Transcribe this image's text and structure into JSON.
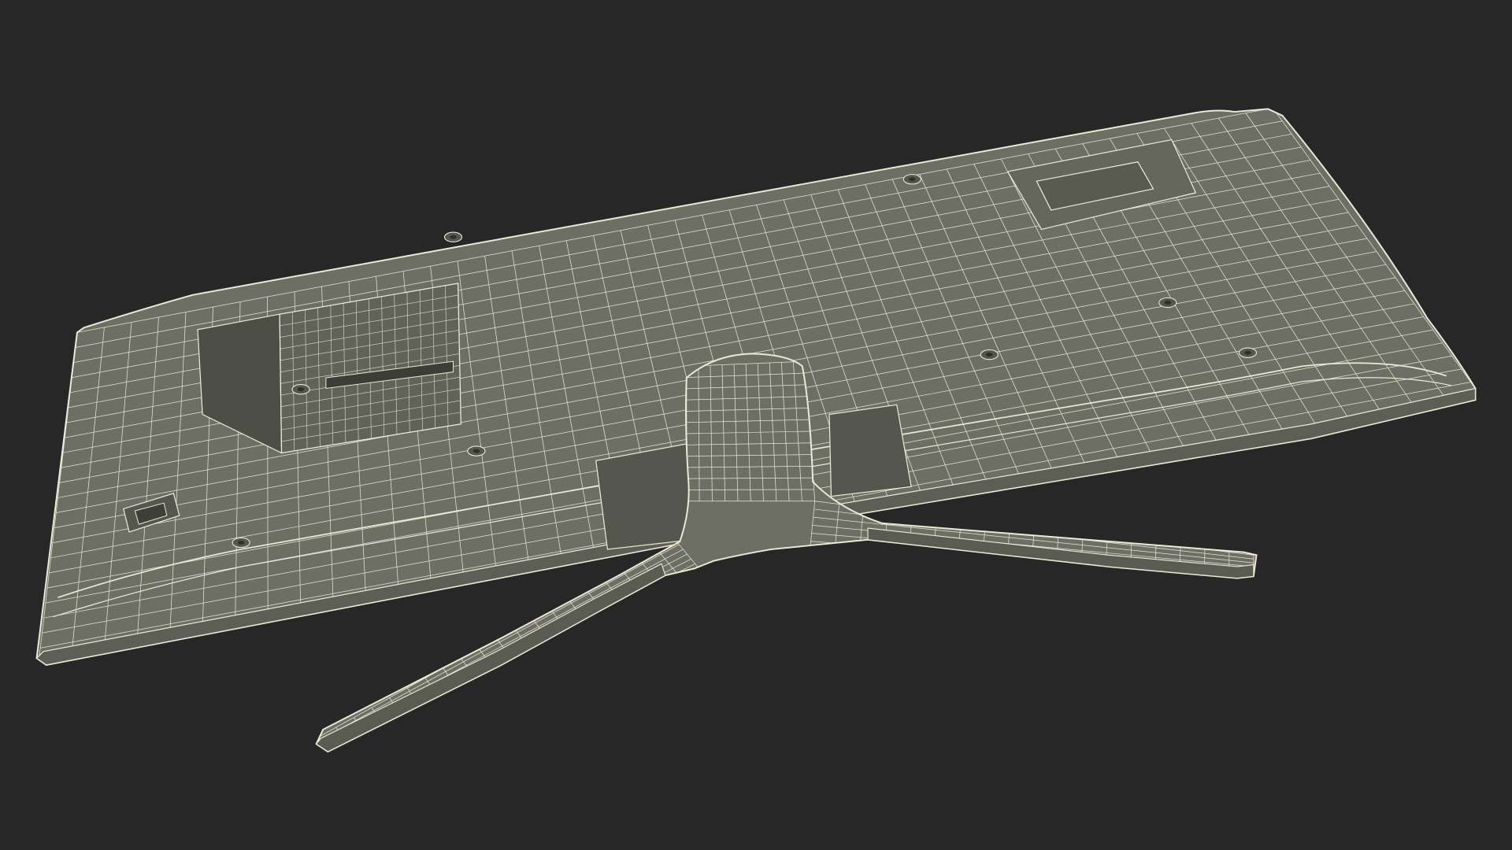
{
  "scene": {
    "subject": "monitor-wireframe-render",
    "colors": {
      "background": "#272727",
      "surface": "#6e6f64",
      "surface_shadow": "#4d4e46",
      "surface_dark": "#3c3d37",
      "wire": "#f4f1e3",
      "outline": "#ecead6"
    }
  }
}
